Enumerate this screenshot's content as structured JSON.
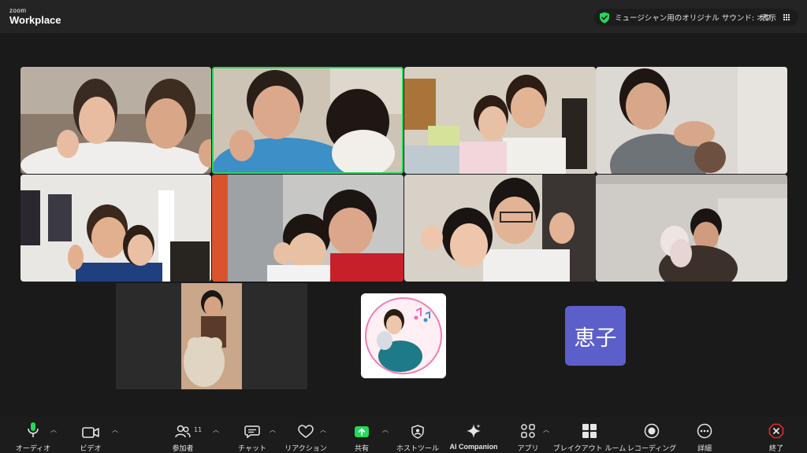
{
  "app": {
    "brand_small": "zoom",
    "brand_big": "Workplace"
  },
  "topbar": {
    "audio_status": "ミュージシャン用のオリジナル サウンド: オフ",
    "view_label": "表示"
  },
  "participants": {
    "avatar_initials": "恵子"
  },
  "toolbar": {
    "audio": "オーディオ",
    "video": "ビデオ",
    "participants": "参加者",
    "participants_count": "11",
    "chat": "チャット",
    "reactions": "リアクション",
    "share": "共有",
    "host_tools": "ホストツール",
    "ai_companion": "AI Companion",
    "apps": "アプリ",
    "breakout": "ブレイクアウト ルーム",
    "recording": "レコーディング",
    "more": "詳細",
    "end": "終了"
  },
  "colors": {
    "active_speaker": "#23d959",
    "share_green": "#23d959",
    "end_red": "#e02828",
    "avatar_bg": "#5c5fc9"
  }
}
